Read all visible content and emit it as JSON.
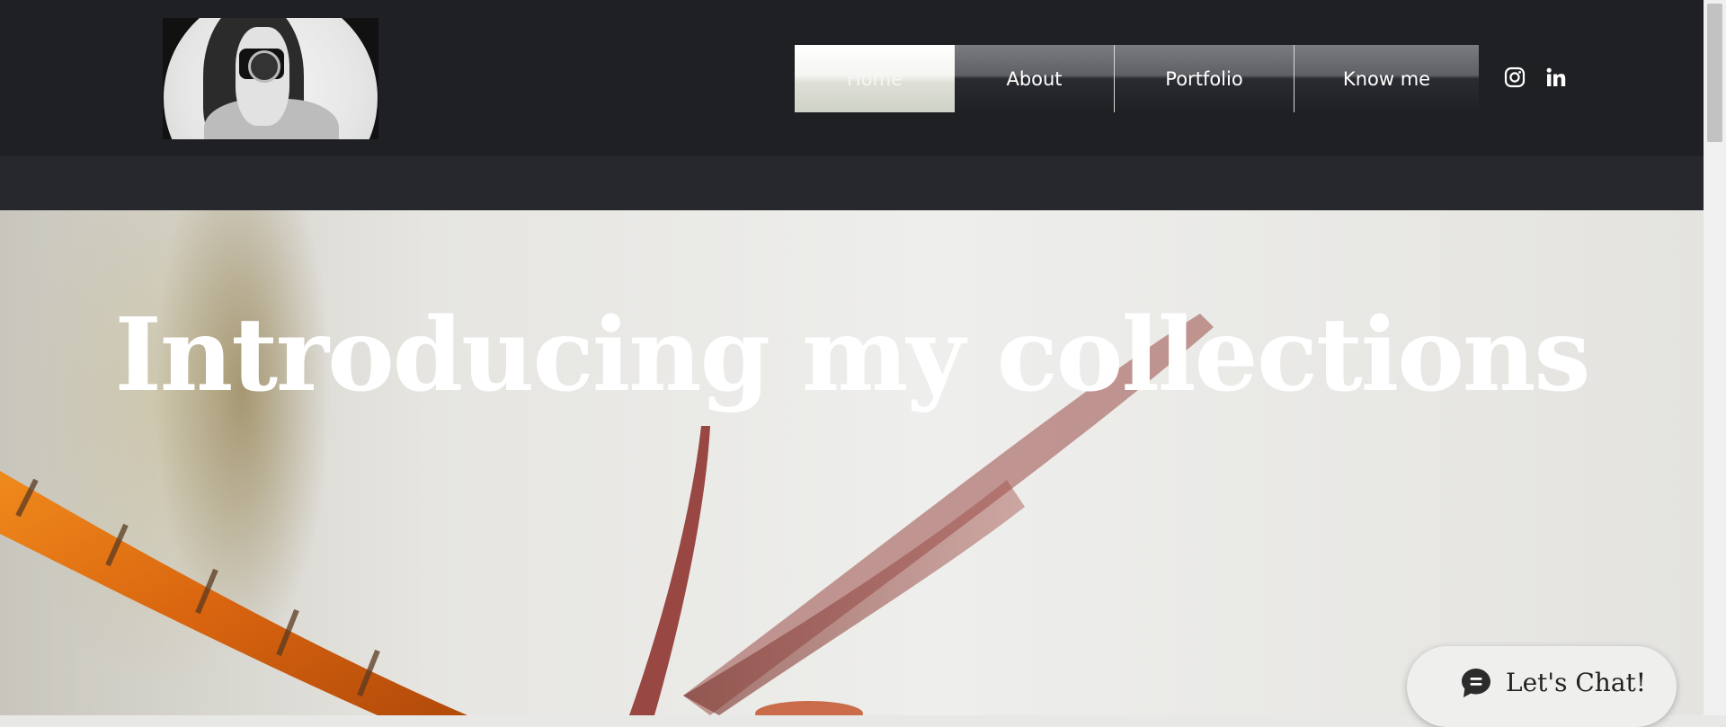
{
  "header": {
    "nav": [
      {
        "label": "Home",
        "active": true
      },
      {
        "label": "About",
        "active": false
      },
      {
        "label": "Portfolio",
        "active": false
      },
      {
        "label": "Know me",
        "active": false
      }
    ],
    "social": [
      "instagram-icon",
      "linkedin-icon"
    ]
  },
  "hero": {
    "title": "Introducing my collections"
  },
  "chat": {
    "label": "Let's Chat!"
  },
  "colors": {
    "header_bg": "#1f2024",
    "subbar_bg": "#27282d",
    "dragonfly_orange": "#e8741a",
    "wing_red": "#8a2a24"
  }
}
